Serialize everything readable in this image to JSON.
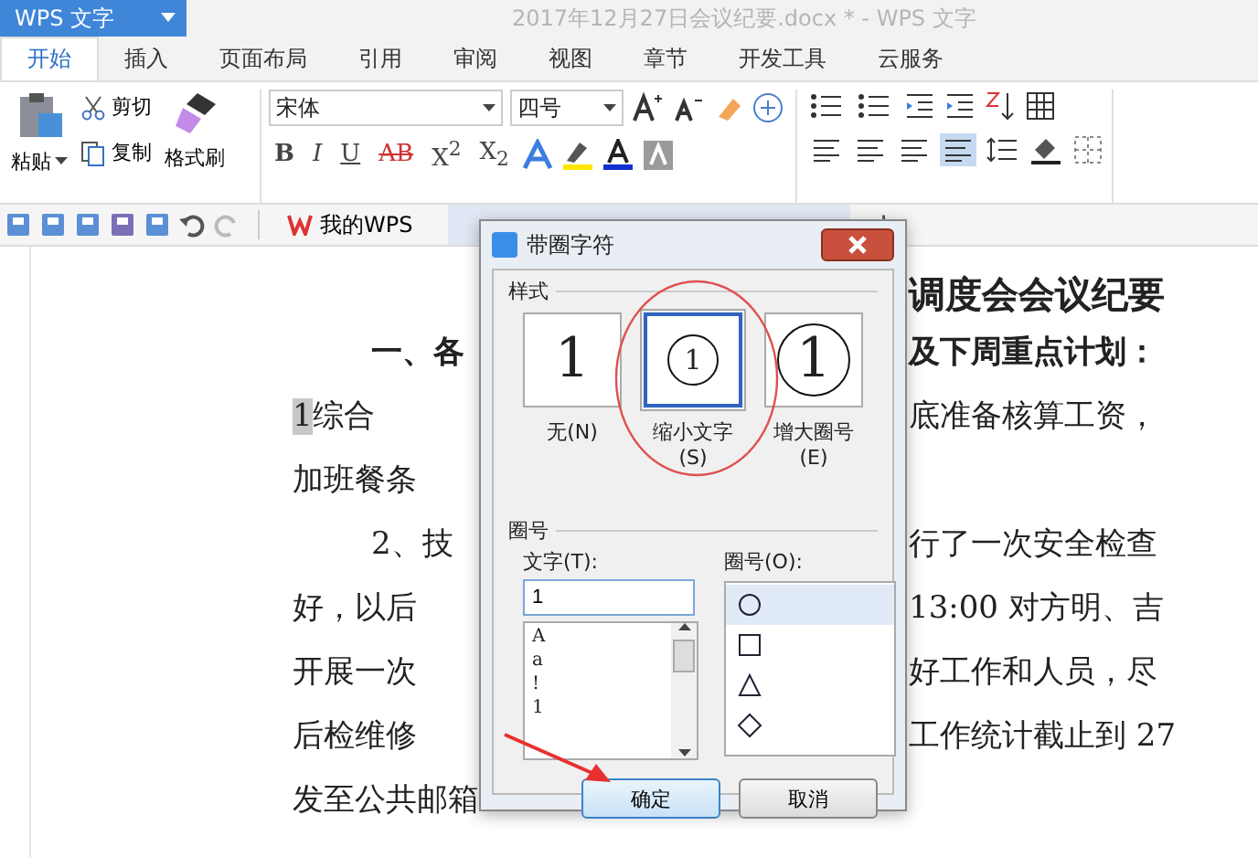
{
  "app_button": "WPS 文字",
  "window": {
    "title": "2017年12月27日会议纪要.docx * - WPS 文字"
  },
  "tabs": [
    {
      "label": "开始",
      "selected": true
    },
    {
      "label": "插入",
      "selected": false
    },
    {
      "label": "页面布局",
      "selected": false
    },
    {
      "label": "引用",
      "selected": false
    },
    {
      "label": "审阅",
      "selected": false
    },
    {
      "label": "视图",
      "selected": false
    },
    {
      "label": "章节",
      "selected": false
    },
    {
      "label": "开发工具",
      "selected": false
    },
    {
      "label": "云服务",
      "selected": false
    }
  ],
  "clipboard": {
    "paste": "粘贴",
    "cut": "剪切",
    "copy": "复制",
    "format_painter": "格式刷"
  },
  "font": {
    "name": "宋体",
    "size": "四号"
  },
  "format_buttons": [
    {
      "label": "B",
      "kind": "bold"
    },
    {
      "label": "I",
      "kind": "italic"
    },
    {
      "label": "U",
      "kind": "underline"
    },
    {
      "label": "AB",
      "kind": "strike"
    },
    {
      "label": "X$^{2}$",
      "kind": "plain"
    },
    {
      "label": "X$_{2}$",
      "kind": "plain"
    }
  ],
  "my_wps": "我的WPS",
  "document": {
    "title": "调度会会议纪要",
    "lines": [
      {
        "kind": "heading",
        "left": "一、各",
        "right": "及下周重点计划："
      },
      {
        "kind": "plain",
        "highlight": "1",
        "left": "综合",
        "right": "底准备核算工资，"
      },
      {
        "kind": "plain",
        "left": "加班餐条"
      },
      {
        "kind": "indented",
        "left": "2、技",
        "right": "行了一次安全检查"
      },
      {
        "kind": "plain",
        "left": "好，以后",
        "right": "13:00 对方明、吉"
      },
      {
        "kind": "plain",
        "left": "开展一次",
        "right": "好工作和人员，尽"
      },
      {
        "kind": "plain",
        "left": "后检维修",
        "right": "工作统计截止到 27"
      },
      {
        "kind": "plain",
        "left": "发至公共邮箱"
      }
    ]
  },
  "dialog": {
    "title": "带圈字符",
    "style_group": "样式",
    "styles": [
      {
        "label": "无(N)",
        "preview": "1",
        "kind": "none",
        "selected": false
      },
      {
        "label": "缩小文字(S)",
        "preview": "1",
        "kind": "shrink",
        "selected": true
      },
      {
        "label": "增大圈号(E)",
        "preview": "1",
        "kind": "enlarge",
        "selected": false
      }
    ],
    "circle_group": "圈号",
    "text_label": "文字(T):",
    "text_value": "1",
    "text_options": [
      {
        "label": "A",
        "selected": false
      },
      {
        "label": "a",
        "selected": false
      },
      {
        "label": "!",
        "selected": false
      },
      {
        "label": "1",
        "selected": false
      }
    ],
    "enclosure_label": "圈号(O):",
    "enclosures": [
      {
        "kind": "circle",
        "selected": true
      },
      {
        "kind": "square",
        "selected": false
      },
      {
        "kind": "triangle",
        "selected": false
      },
      {
        "kind": "diamond",
        "selected": false
      }
    ],
    "ok": "确定",
    "cancel": "取消"
  }
}
